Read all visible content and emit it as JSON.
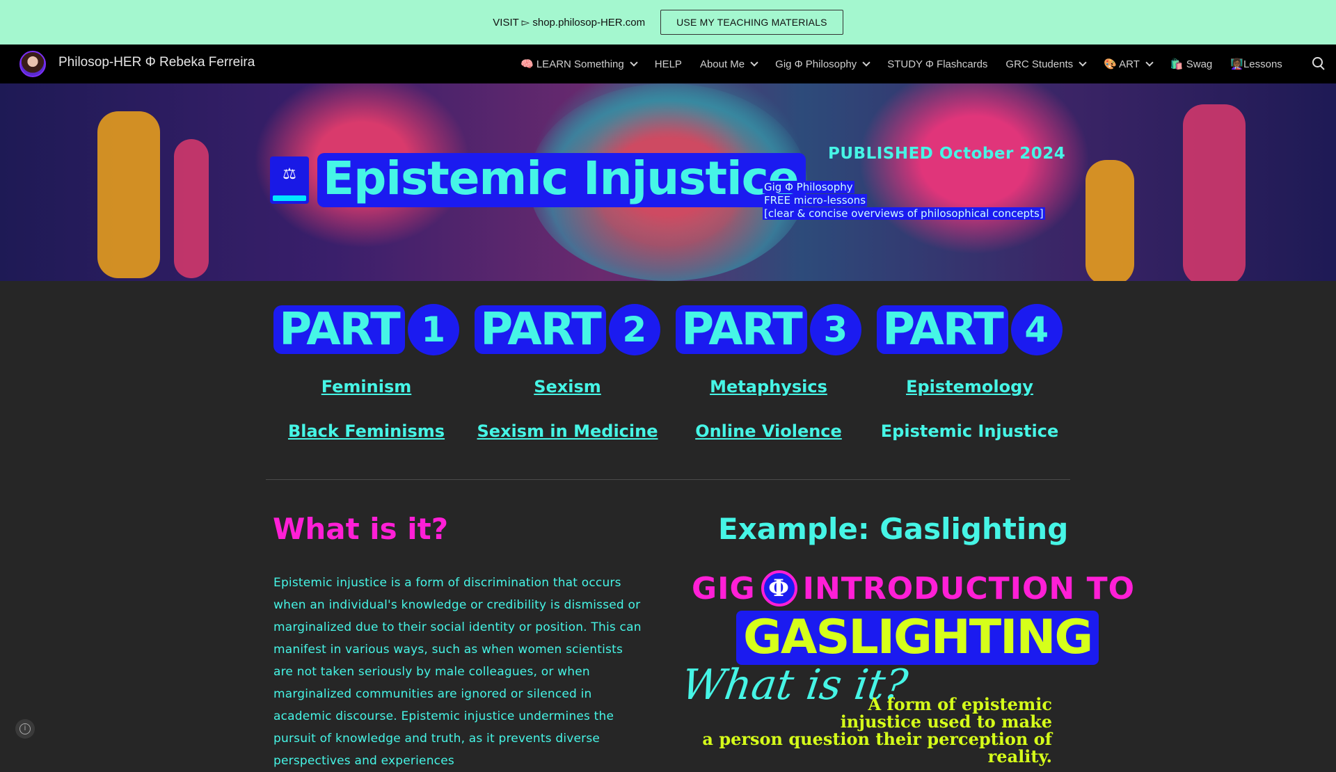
{
  "announcement": {
    "text": "VISIT ▻ shop.philosop-HER.com",
    "button_label": "USE MY TEACHING MATERIALS"
  },
  "nav": {
    "site_title": "Philosop-HER Φ Rebeka Ferreira",
    "items": [
      {
        "label": "🧠 LEARN Something",
        "dropdown": true
      },
      {
        "label": "HELP",
        "dropdown": false
      },
      {
        "label": "About Me",
        "dropdown": true
      },
      {
        "label": "Gig Φ Philosophy",
        "dropdown": true
      },
      {
        "label": "STUDY Φ Flashcards",
        "dropdown": false
      },
      {
        "label": "GRC Students",
        "dropdown": true
      },
      {
        "label": "🎨 ART",
        "dropdown": true
      },
      {
        "label": "🛍️ Swag",
        "dropdown": false
      },
      {
        "label": "👩🏾‍🏫Lessons",
        "dropdown": false
      }
    ]
  },
  "hero": {
    "title": "Epistemic Injustice",
    "published": "PUBLISHED October 2024",
    "sub_lines": [
      "Gig Φ Philosophy",
      "FREE micro-lessons",
      "[clear & concise overviews of philosophical concepts]"
    ]
  },
  "parts": [
    {
      "word": "PART",
      "num": "1",
      "link1": "Feminism",
      "link2": "Black Feminisms"
    },
    {
      "word": "PART",
      "num": "2",
      "link1": "Sexism",
      "link2": "Sexism in Medicine"
    },
    {
      "word": "PART",
      "num": "3",
      "link1": "Metaphysics",
      "link2": "Online Violence"
    },
    {
      "word": "PART",
      "num": "4",
      "link1": "Epistemology",
      "link2": "Epistemic Injustice"
    }
  ],
  "left": {
    "heading": "What is it?",
    "body": "Epistemic injustice is a form of discrimination that occurs when an individual's knowledge or credibility is dismissed or marginalized due to their social identity or position. This can manifest in various ways, such as when women scientists are not taken seriously by male colleagues, or when marginalized communities are ignored or silenced in academic discourse. Epistemic injustice undermines the pursuit of knowledge and truth, as it prevents diverse perspectives and experiences"
  },
  "right": {
    "heading": "Example: Gaslighting",
    "graphic": {
      "gig": "GIG",
      "phi": "Φ",
      "intro": "INTRODUCTION TO",
      "gaslighting": "GASLIGHTING",
      "what": "What is it?",
      "definition_lines": [
        "A form of epistemic",
        "injustice used to make",
        "a person question their perception of reality."
      ]
    }
  }
}
